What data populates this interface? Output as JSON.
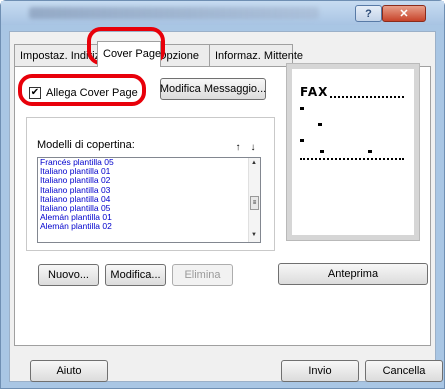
{
  "window": {
    "help": "?",
    "close": "✕"
  },
  "tabs": [
    "Impostaz. Indirizzo",
    "Cover Page",
    "Opzione",
    "Informaz. Mittente"
  ],
  "cover": {
    "attach_label": "Allega Cover Page",
    "edit_message": "Modifica Messaggio...",
    "models_label": "Modelli di copertina:",
    "models": [
      "Francés plantilla 05",
      "Italiano plantilla 01",
      "Italiano plantilla 02",
      "Italiano plantilla 03",
      "Italiano plantilla 04",
      "Italiano plantilla 05",
      "Alemán plantilla 01",
      "Alemán plantilla 02"
    ],
    "buttons": {
      "new": "Nuovo...",
      "modify": "Modifica...",
      "delete": "Elimina",
      "preview": "Anteprima"
    },
    "preview_title": "FAX"
  },
  "footer": {
    "help": "Aiuto",
    "send": "Invio",
    "cancel": "Cancella"
  },
  "colors": {
    "annotation": "#e8000a",
    "link": "#0000cc"
  }
}
